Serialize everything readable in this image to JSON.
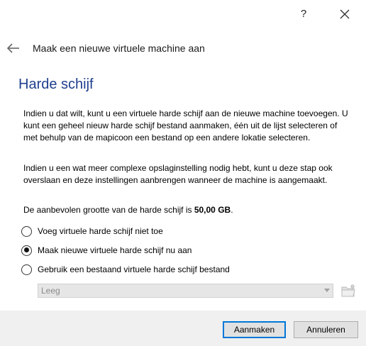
{
  "titlebar": {
    "help_label": "?",
    "close_icon": "close-icon"
  },
  "wizard": {
    "back_icon": "back-arrow-icon",
    "title": "Maak een nieuwe virtuele machine aan"
  },
  "page": {
    "heading": "Harde schijf",
    "paragraph1": "Indien u dat wilt, kunt u een virtuele harde schijf aan de nieuwe machine toevoegen. U kunt een geheel nieuw harde schijf bestand aanmaken, één uit de lijst selecteren of met behulp van de mapicoon een bestand op een andere lokatie selecteren.",
    "paragraph2": "Indien u een wat meer complexe opslaginstelling nodig hebt, kunt u deze stap ook overslaan en deze instellingen aanbrengen wanneer de machine is aangemaakt.",
    "size_prefix": "De aanbevolen grootte van de harde schijf is ",
    "size_value": "50,00 GB",
    "size_suffix": "."
  },
  "options": [
    {
      "label": "Voeg virtuele harde schijf niet toe",
      "checked": false
    },
    {
      "label": "Maak nieuwe virtuele harde schijf nu aan",
      "checked": true
    },
    {
      "label": "Gebruik een bestaand virtuele harde schijf bestand",
      "checked": false
    }
  ],
  "existing_disk": {
    "selected_value": "Leeg",
    "enabled": false,
    "folder_icon": "folder-open-icon"
  },
  "buttons": {
    "create": "Aanmaken",
    "cancel": "Annuleren"
  },
  "colors": {
    "heading": "#1f3f8f",
    "default_button_border": "#0078d7",
    "footer_bg": "#f0f0f0"
  }
}
